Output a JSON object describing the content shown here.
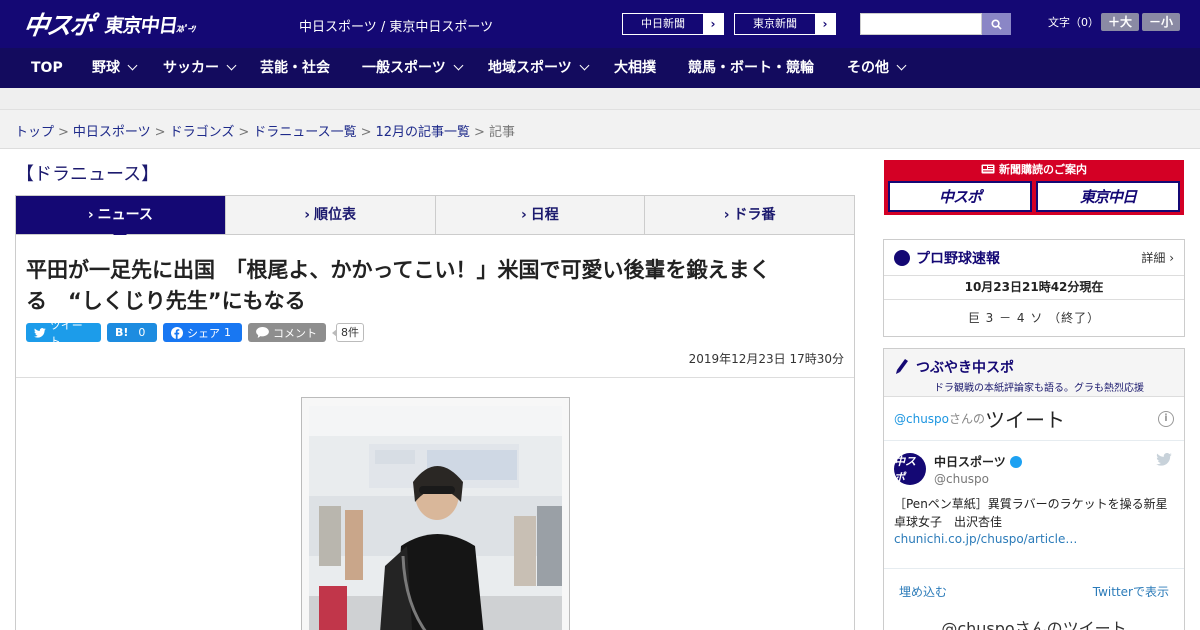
{
  "header": {
    "logo_main": "中スポ",
    "logo_sub": "東京中日",
    "logo_sub_small": "ｽﾎﾟｰﾂ",
    "site_title": "中日スポーツ / 東京中日スポーツ",
    "ext_links": [
      {
        "label": "中日新聞"
      },
      {
        "label": "東京新聞"
      }
    ],
    "search_placeholder": "",
    "font_label": "文字（0）",
    "font_bigger": "＋大",
    "font_smaller": "－小"
  },
  "nav": {
    "items": [
      {
        "label": "TOP",
        "has_menu": false
      },
      {
        "label": "野球",
        "has_menu": true
      },
      {
        "label": "サッカー",
        "has_menu": true
      },
      {
        "label": "芸能・社会",
        "has_menu": false
      },
      {
        "label": "一般スポーツ",
        "has_menu": true
      },
      {
        "label": "地域スポーツ",
        "has_menu": true
      },
      {
        "label": "大相撲",
        "has_menu": false
      },
      {
        "label": "競馬・ボート・競輪",
        "has_menu": false
      },
      {
        "label": "その他",
        "has_menu": true
      }
    ]
  },
  "breadcrumb": {
    "items": [
      "トップ",
      "中日スポーツ",
      "ドラゴンズ",
      "ドラニュース一覧",
      "12月の記事一覧"
    ],
    "current": "記事",
    "separator": ">"
  },
  "main": {
    "section_title": "【ドラニュース】",
    "tabs": [
      {
        "label": "ニュース",
        "active": true
      },
      {
        "label": "順位表",
        "active": false
      },
      {
        "label": "日程",
        "active": false
      },
      {
        "label": "ドラ番",
        "active": false
      }
    ],
    "tab_marker": "›"
  },
  "article": {
    "headline": "平田が一足先に出国　「根尾よ、かかってこい！」米国で可愛い後輩を鍛えまくる　“しくじり先生”にもなる",
    "social": {
      "tweet_label": "ツイート",
      "hatena_label": "B!",
      "hatena_count": "0",
      "share_label": "シェア",
      "share_count": "1",
      "comment_label": "コメント",
      "comment_count": "8件"
    },
    "published": "2019年12月23日 17時30分"
  },
  "sidebar": {
    "subscribe": {
      "header": "新聞購読のご案内",
      "logo1": "中スポ",
      "logo2": "東京中日"
    },
    "score": {
      "title": "プロ野球速報",
      "more": "詳細 ›",
      "updated": "10月23日21時42分現在",
      "line": "巨 3 － 4 ソ （終了）"
    },
    "tweets": {
      "title": "つぶやき中スポ",
      "subtitle": "ドラ観戦の本紙評論家も語る。グラも熱烈応援",
      "timeline_handle": "@chuspo",
      "timeline_handle_suffix": "さんの",
      "timeline_word": "ツイート",
      "info": "i",
      "tweet": {
        "name": "中日スポーツ",
        "handle": "@chuspo",
        "text": "［Penペン草紙］異質ラバーのラケットを操る新星　卓球女子　出沢杏佳",
        "link": "chunichi.co.jp/chuspo/article…"
      },
      "embed_label": "埋め込む",
      "view_label": "Twitterで表示",
      "footer_text": "@chuspoさんのツイート"
    }
  }
}
